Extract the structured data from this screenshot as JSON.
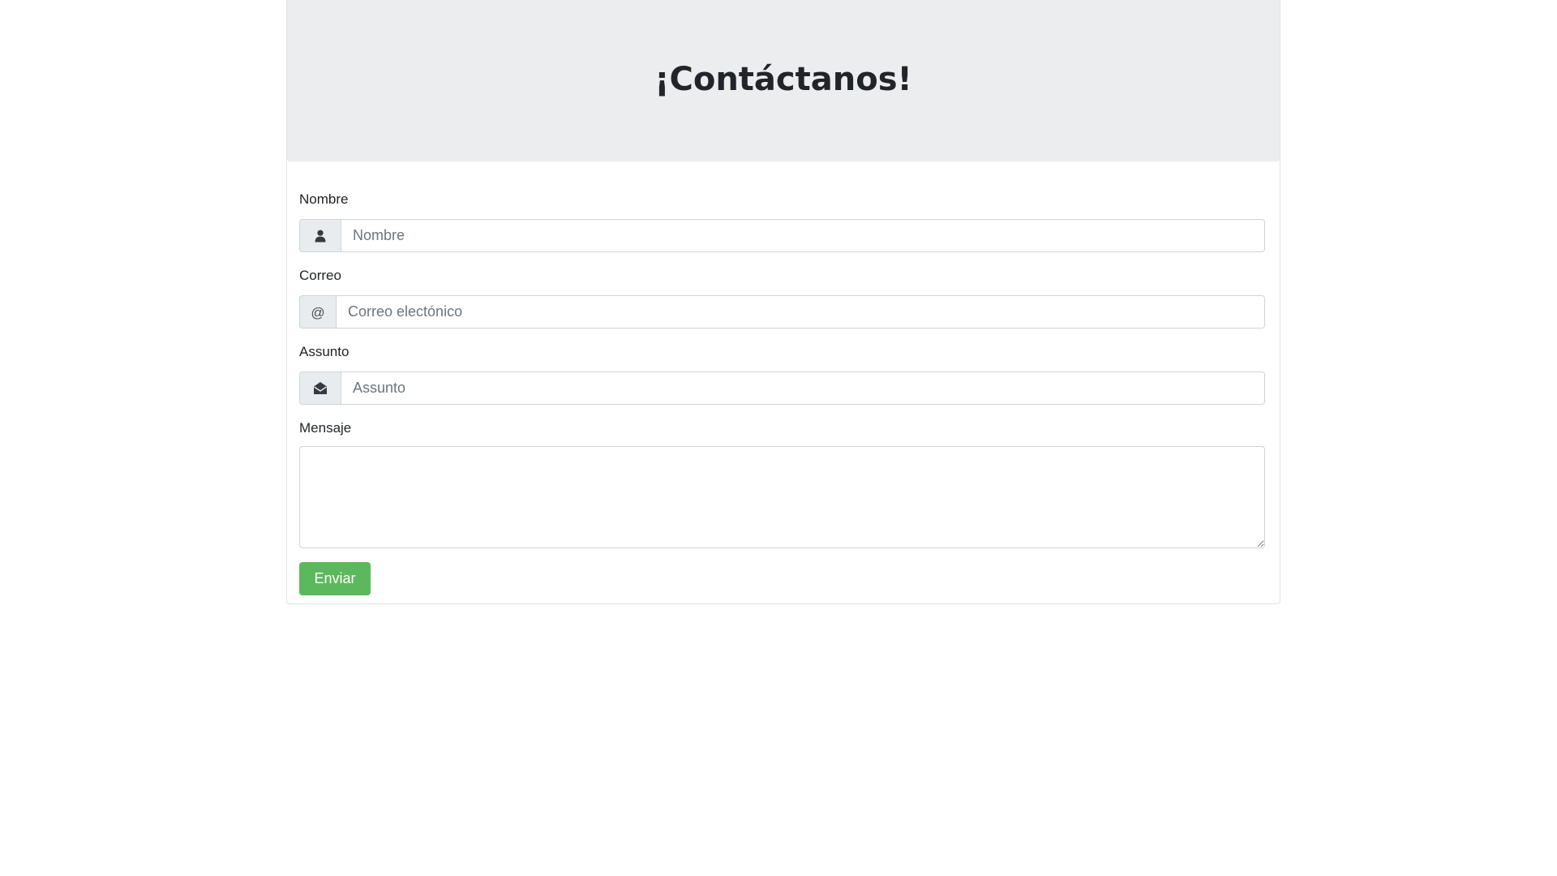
{
  "header": {
    "title": "¡Contáctanos!"
  },
  "form": {
    "name": {
      "label": "Nombre",
      "placeholder": "Nombre",
      "icon": "user-icon"
    },
    "email": {
      "label": "Correo",
      "placeholder": "Correo electónico",
      "addon_text": "@",
      "icon": "at-icon"
    },
    "subject": {
      "label": "Assunto",
      "placeholder": "Assunto",
      "icon": "envelope-open-icon"
    },
    "message": {
      "label": "Mensaje",
      "value": ""
    },
    "submit_label": "Enviar"
  },
  "colors": {
    "jumbotron_bg": "#ecedef",
    "submit_bg": "#5cb85c",
    "addon_bg": "#e9ecef",
    "border": "#ced4da"
  }
}
